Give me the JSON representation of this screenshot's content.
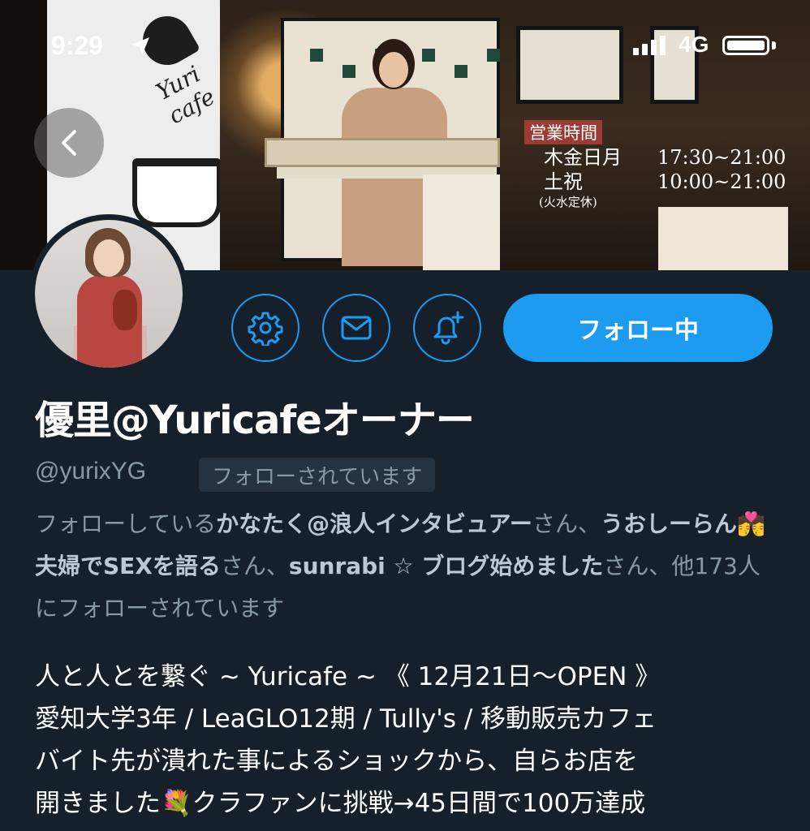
{
  "status_bar": {
    "time": "9:29",
    "network": "4G"
  },
  "banner": {
    "logo_text": "Yuri cafe",
    "hours_title": "営業時間",
    "hours": [
      {
        "days": "木金日月",
        "time": "17:30~21:00"
      },
      {
        "days": "土祝",
        "time": "10:00~21:00"
      }
    ],
    "hours_note": "(火水定休)"
  },
  "actions": {
    "follow_label": "フォロー中"
  },
  "profile": {
    "name": "優里@Yuricafeオーナー",
    "handle": "@yurixYG",
    "follows_you": "フォローされています",
    "followed_by": {
      "prefix": "フォローしている",
      "user1": "かなたく@浪人インタビュアー",
      "sep1": "さん、",
      "user2": "うおしーらん💏夫婦でSEXを語る",
      "sep2": "さん、",
      "user3": "sunrabi ☆ ブログ始めました",
      "suffix": "さん、他173人にフォローされています"
    },
    "bio_lines": [
      "人と人とを繋ぐ ~ Yuricafe ~ 《 12月21日〜OPEN 》",
      "愛知大学3年 / LeaGLO12期 / Tully's / 移動販売カフェ",
      "バイト先が潰れた事によるショックから、自らお店を",
      "開きました💐クラファンに挑戦→45日間で100万達成"
    ]
  },
  "icons": [
    "back-icon",
    "gear-icon",
    "mail-icon",
    "bell-plus-icon",
    "location-arrow-icon",
    "signal-icon",
    "battery-icon"
  ]
}
